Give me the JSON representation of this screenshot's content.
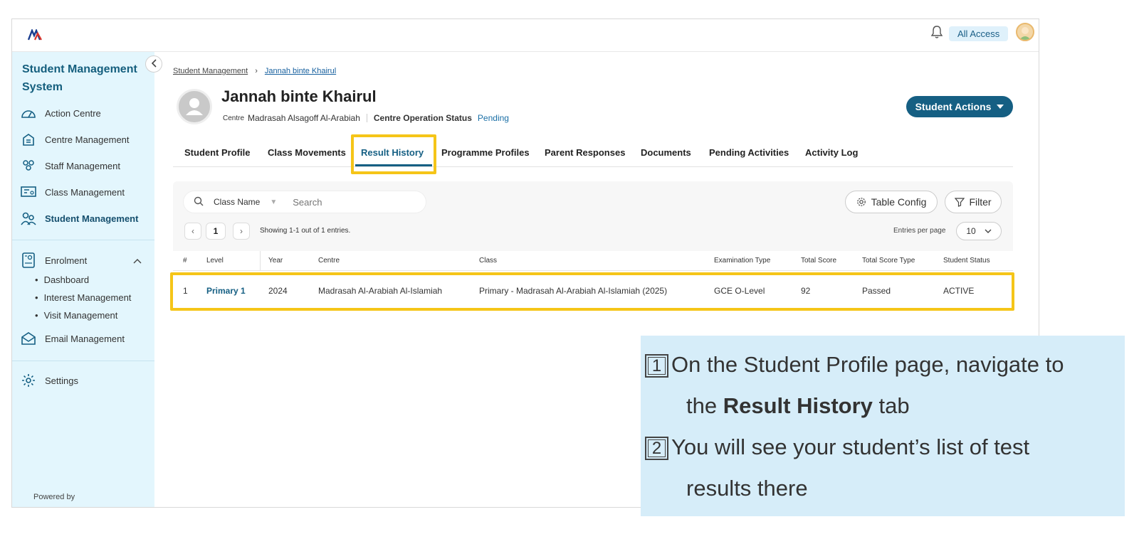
{
  "topbar": {
    "access_label": "All Access"
  },
  "sidebar": {
    "title": "Student Management System",
    "items": [
      {
        "label": "Action Centre",
        "icon": "gauge-icon"
      },
      {
        "label": "Centre Management",
        "icon": "building-icon"
      },
      {
        "label": "Staff Management",
        "icon": "staff-icon"
      },
      {
        "label": "Class Management",
        "icon": "class-icon"
      },
      {
        "label": "Student Management",
        "icon": "students-icon",
        "active": true
      }
    ],
    "enrolment": {
      "label": "Enrolment",
      "sub_items": [
        "Dashboard",
        "Interest Management",
        "Visit Management"
      ]
    },
    "email_label": "Email Management",
    "settings_label": "Settings",
    "powered_by": "Powered by"
  },
  "breadcrumb": {
    "root": "Student Management",
    "current": "Jannah binte Khairul"
  },
  "student": {
    "name": "Jannah binte Khairul",
    "centre_label": "Centre",
    "centre_value": "Madrasah Alsagoff Al-Arabiah",
    "status_label": "Centre Operation Status",
    "status_value": "Pending"
  },
  "actions_label": "Student Actions",
  "tabs": [
    "Student Profile",
    "Class Movements",
    "Result History",
    "Programme Profiles",
    "Parent Responses",
    "Documents",
    "Pending Activities",
    "Activity Log"
  ],
  "active_tab": "Result History",
  "toolbar": {
    "filter_field": "Class Name",
    "search_placeholder": "Search",
    "table_config_label": "Table Config",
    "filter_label": "Filter",
    "page_number": "1",
    "showing_text": "Showing 1-1 out of 1 entries.",
    "per_page_label": "Entries per page",
    "per_page_value": "10"
  },
  "table": {
    "columns": [
      "#",
      "Level",
      "Year",
      "Centre",
      "Class",
      "Examination Type",
      "Total Score",
      "Total Score Type",
      "Student Status"
    ],
    "rows": [
      [
        "1",
        "Primary 1",
        "2024",
        "Madrasah Al-Arabiah Al-Islamiah",
        "Primary - Madrasah Al-Arabiah Al-Islamiah (2025)",
        "GCE O-Level",
        "92",
        "Passed",
        "ACTIVE"
      ]
    ]
  },
  "callout": {
    "step1_num": "1",
    "step1_line1": "On the Student Profile page, navigate to",
    "step1_pre": "the ",
    "step1_bold": "Result History",
    "step1_post": " tab",
    "step2_num": "2",
    "step2_line1": "You will see your student’s list of test",
    "step2_line2": "results there"
  },
  "colors": {
    "brand": "#155f83",
    "sidebar_bg": "#e3f6fd",
    "highlight": "#f5c518",
    "callout_bg": "#d6edf9"
  }
}
